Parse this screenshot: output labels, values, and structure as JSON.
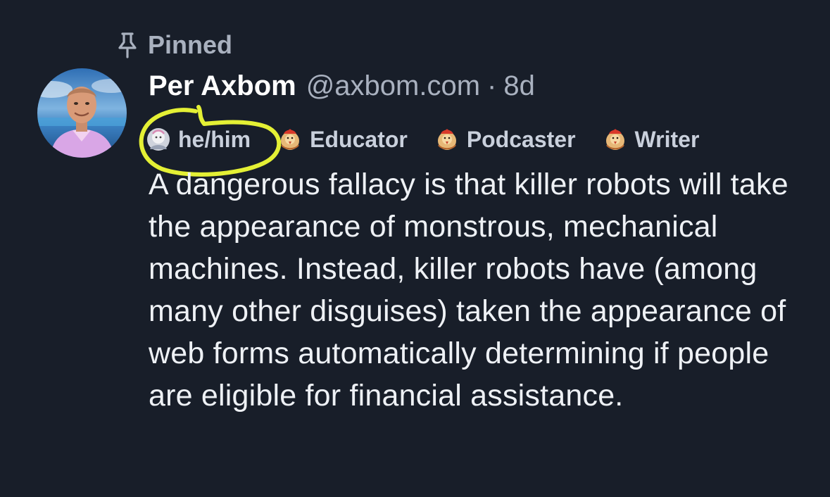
{
  "pinned": {
    "label": "Pinned",
    "icon": "pin-icon"
  },
  "author": {
    "name": "Per Axbom",
    "handle": "@axbom.com",
    "separator": "·",
    "age": "8d",
    "avatar_icon": "profile-photo"
  },
  "badges": [
    {
      "label": "he/him",
      "icon": "avatar-emoji-icon"
    },
    {
      "label": "Educator",
      "icon": "rooster-emoji-icon"
    },
    {
      "label": "Podcaster",
      "icon": "rooster-emoji-icon"
    },
    {
      "label": "Writer",
      "icon": "rooster-emoji-icon"
    }
  ],
  "annotation": {
    "color": "#e4f035",
    "target": "he/him"
  },
  "post": {
    "text": "A dangerous fallacy is that killer robots will take the appearance of monstrous, mechanical machines. Instead, killer robots have (among many other disguises) taken the appearance of web forms automatically determining if people are eligible for financial assistance."
  },
  "colors": {
    "background": "#181e29",
    "secondary_text": "#a9b1bf",
    "primary_text": "#ffffff"
  }
}
